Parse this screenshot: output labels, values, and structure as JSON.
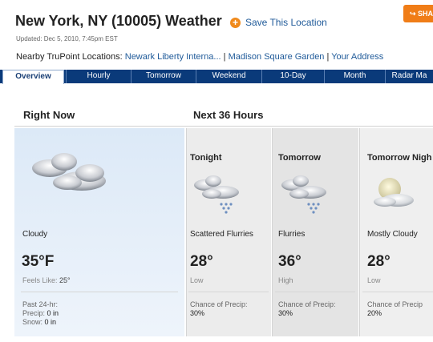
{
  "header": {
    "title": "New York, NY (10005) Weather",
    "save_icon": "plus-icon",
    "save_label": "Save This Location",
    "share_label": "SHA",
    "share_icon": "share-icon",
    "updated": "Updated: Dec 5, 2010, 7:45pm EST",
    "nearby_label": "Nearby TruPoint Locations:",
    "nearby_links": [
      "Newark Liberty Interna...",
      "Madison Square Garden",
      "Your Address"
    ],
    "separator": "|"
  },
  "tabs": [
    "Overview",
    "Hourly",
    "Tomorrow",
    "Weekend",
    "10-Day",
    "Month",
    "Radar Ma"
  ],
  "active_tab": "Overview",
  "sections": {
    "right_now": "Right Now",
    "next36": "Next 36 Hours"
  },
  "now": {
    "icon": "cloudy-icon",
    "condition": "Cloudy",
    "temp": "35°F",
    "feels_label": "Feels Like:",
    "feels_value": "25°",
    "past_label": "Past 24-hr:",
    "precip_label": "Precip:",
    "precip_value": "0 in",
    "snow_label": "Snow:",
    "snow_value": "0 in"
  },
  "forecast": [
    {
      "period": "Tonight",
      "icon": "snow-flurries-icon",
      "condition": "Scattered Flurries",
      "temp": "28°",
      "sub": "Low",
      "precip_label": "Chance of Precip:",
      "precip": "30%"
    },
    {
      "period": "Tomorrow",
      "icon": "snow-flurries-icon",
      "condition": "Flurries",
      "temp": "36°",
      "sub": "High",
      "precip_label": "Chance of Precip:",
      "precip": "30%"
    },
    {
      "period": "Tomorrow Nigh",
      "icon": "mostly-cloudy-night-icon",
      "condition": "Mostly Cloudy",
      "temp": "28°",
      "sub": "Low",
      "precip_label": "Chance of Precip",
      "precip": "20%"
    }
  ],
  "colors": {
    "link": "#1f5a99",
    "tab_bar": "#0a3a7a",
    "accent": "#f07d17"
  }
}
